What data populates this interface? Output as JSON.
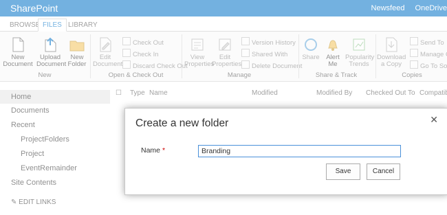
{
  "suite": {
    "brand": "SharePoint",
    "links": [
      "Newsfeed",
      "OneDrive"
    ]
  },
  "tabs": [
    "BROWSE",
    "FILES",
    "LIBRARY"
  ],
  "ribbon": {
    "new_group": {
      "label": "New",
      "buttons": [
        "New Document",
        "Upload Document",
        "New Folder"
      ]
    },
    "open_group": {
      "label": "Open & Check Out",
      "large": "Edit Document",
      "small": [
        "Check Out",
        "Check In",
        "Discard Check Out"
      ]
    },
    "manage_group": {
      "label": "Manage",
      "large": [
        "View Properties",
        "Edit Properties"
      ],
      "small": [
        "Version History",
        "Shared With",
        "Delete Document"
      ]
    },
    "share_group": {
      "label": "Share & Track",
      "buttons": [
        "Share",
        "Alert Me",
        "Popularity Trends"
      ]
    },
    "copies_group": {
      "label": "Copies",
      "large": "Download a Copy",
      "small": [
        "Send To",
        "Manage Copies",
        "Go To Source"
      ]
    }
  },
  "nav": {
    "items": [
      "Home",
      "Documents",
      "Recent",
      "ProjectFolders",
      "Project",
      "EventRemainder",
      "Site Contents"
    ],
    "edit_links": "EDIT LINKS"
  },
  "list": {
    "headers": [
      "Type",
      "Name",
      "Modified",
      "Modified By",
      "Checked Out To",
      "Compatible"
    ]
  },
  "dialog": {
    "title": "Create a new folder",
    "name_label": "Name",
    "required_mark": "*",
    "name_value": "Branding",
    "save": "Save",
    "cancel": "Cancel",
    "close": "✕"
  }
}
